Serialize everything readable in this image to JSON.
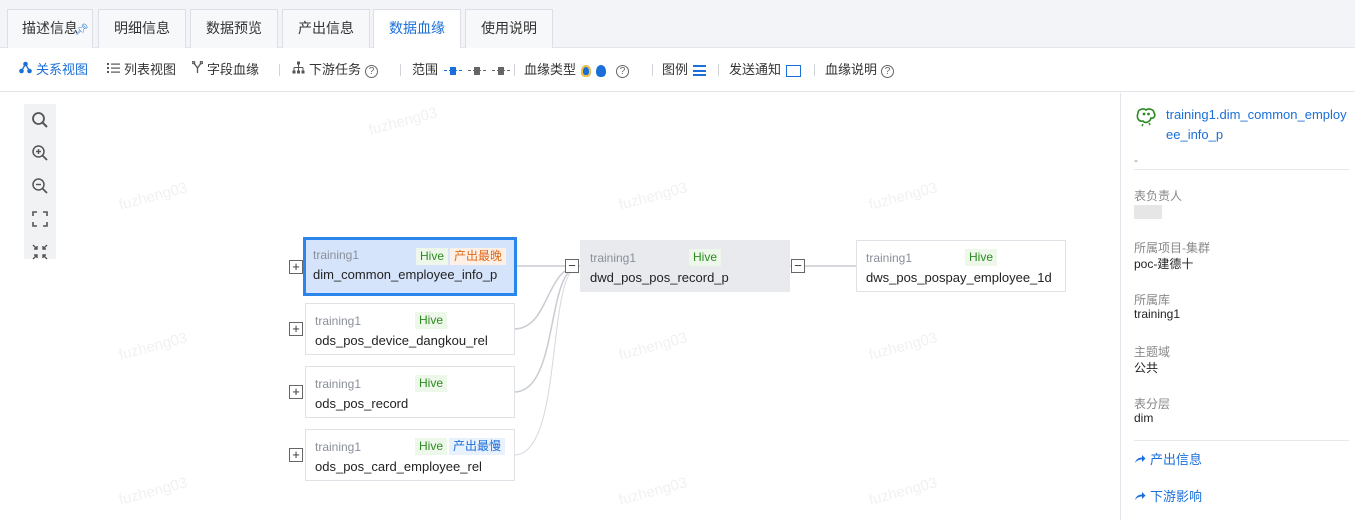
{
  "tabs": [
    {
      "label": "描述信息",
      "pinned": true
    },
    {
      "label": "明细信息"
    },
    {
      "label": "数据预览"
    },
    {
      "label": "产出信息"
    },
    {
      "label": "数据血缘",
      "active": true
    },
    {
      "label": "使用说明"
    }
  ],
  "toolbar": {
    "relation_view": "关系视图",
    "list_view": "列表视图",
    "field_lineage": "字段血缘",
    "downstream_tasks": "下游任务",
    "range": "范围",
    "lineage_type": "血缘类型",
    "legend": "图例",
    "send_notice": "发送通知",
    "lineage_desc": "血缘说明",
    "help_glyph": "?"
  },
  "graph": {
    "nodes": [
      {
        "db": "training1",
        "name": "dim_common_employee_info_p",
        "tag": "Hive",
        "extra": "产出最晚",
        "selected": true
      },
      {
        "db": "training1",
        "name": "ods_pos_device_dangkou_rel",
        "tag": "Hive"
      },
      {
        "db": "training1",
        "name": "ods_pos_record",
        "tag": "Hive"
      },
      {
        "db": "training1",
        "name": "ods_pos_card_employee_rel",
        "tag": "Hive",
        "extra": "产出最慢"
      },
      {
        "db": "training1",
        "name": "dwd_pos_pos_record_p",
        "tag": "Hive"
      },
      {
        "db": "training1",
        "name": "dws_pos_pospay_employee_1d",
        "tag": "Hive"
      }
    ],
    "expand_glyph": "+",
    "collapse_glyph": "−",
    "watermark": "fuzheng03"
  },
  "panel": {
    "title": "training1.dim_common_employee_info_p",
    "desc": "-",
    "owner_label": "表负责人",
    "project_label": "所属项目-集群",
    "project_value": "poc-建德十",
    "db_label": "所属库",
    "db_value": "training1",
    "domain_label": "主题域",
    "domain_value": "公共",
    "layer_label": "表分层",
    "layer_value": "dim",
    "link_output": "产出信息",
    "link_impact": "下游影响"
  },
  "colors": {
    "accent": "#1a6fd8",
    "hive": "#2b8a1f",
    "late": "#e06a1b"
  }
}
